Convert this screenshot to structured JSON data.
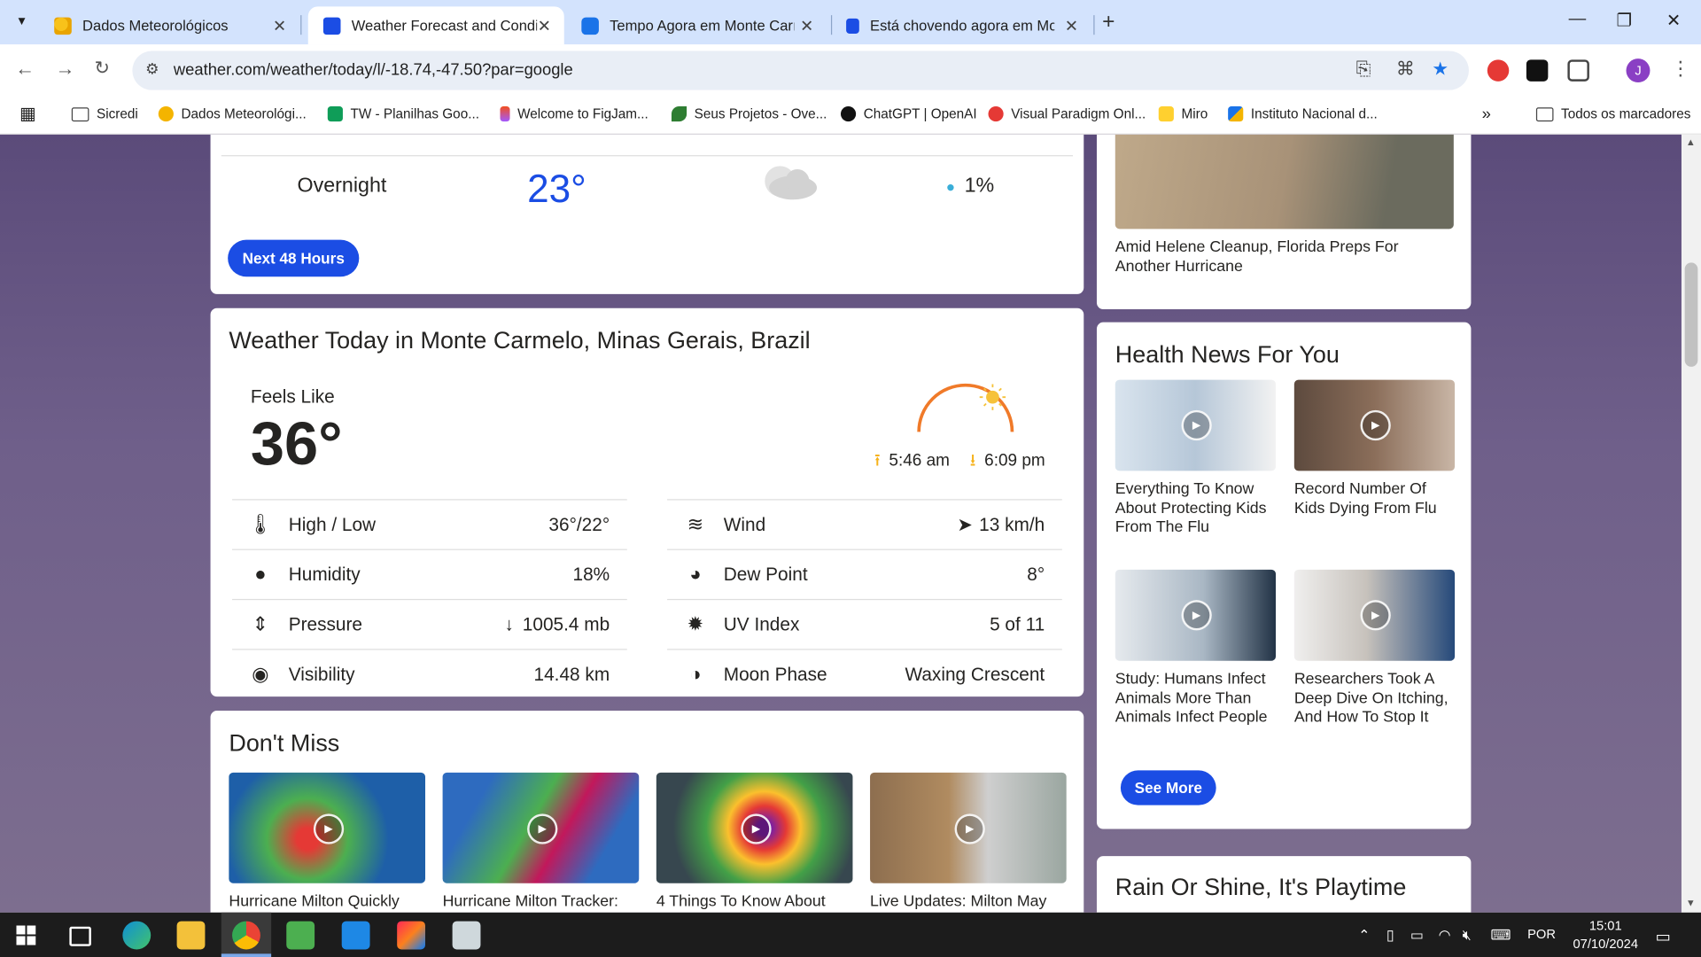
{
  "tabs": [
    {
      "title": "Dados Meteorológicos",
      "favicon_color": "#f4b400"
    },
    {
      "title": "Weather Forecast and Conditions",
      "favicon_color": "#1b4de4"
    },
    {
      "title": "Tempo Agora em Monte Carmelo",
      "favicon_color": "#1a73e8"
    },
    {
      "title": "Está chovendo agora em Monte Carmelo",
      "favicon_color": "#1b4de4"
    }
  ],
  "address": {
    "url": "weather.com/weather/today/l/-18.74,-47.50?par=google"
  },
  "bookmarks": [
    {
      "label": "Sicredi"
    },
    {
      "label": "Dados Meteorológi..."
    },
    {
      "label": "TW - Planilhas Goo..."
    },
    {
      "label": "Welcome to FigJam..."
    },
    {
      "label": "Seus Projetos - Ove..."
    },
    {
      "label": "ChatGPT | OpenAI"
    },
    {
      "label": "Visual Paradigm Onl..."
    },
    {
      "label": "Miro"
    },
    {
      "label": "Instituto Nacional d..."
    },
    {
      "label": "Todos os marcadores"
    }
  ],
  "overnight": {
    "label": "Overnight",
    "temp": "23°",
    "precip": "1%"
  },
  "next48_label": "Next 48 Hours",
  "today": {
    "title": "Weather Today in Monte Carmelo, Minas Gerais, Brazil",
    "feels_like_label": "Feels Like",
    "feels_like_value": "36°",
    "sunrise": "5:46 am",
    "sunset": "6:09 pm",
    "details_left": [
      {
        "label": "High / Low",
        "value": "36°/22°",
        "icon": "thermometer-icon"
      },
      {
        "label": "Humidity",
        "value": "18%",
        "icon": "humidity-icon"
      },
      {
        "label": "Pressure",
        "value": "1005.4 mb",
        "icon": "pressure-icon"
      },
      {
        "label": "Visibility",
        "value": "14.48 km",
        "icon": "visibility-icon"
      }
    ],
    "details_right": [
      {
        "label": "Wind",
        "value": "13 km/h",
        "icon": "wind-icon"
      },
      {
        "label": "Dew Point",
        "value": "8°",
        "icon": "dew-point-icon"
      },
      {
        "label": "UV Index",
        "value": "5 of 11",
        "icon": "uv-index-icon"
      },
      {
        "label": "Moon Phase",
        "value": "Waxing Crescent",
        "icon": "moon-phase-icon"
      }
    ]
  },
  "dont_miss": {
    "title": "Don't Miss",
    "items": [
      {
        "caption": "Hurricane Milton Quickly"
      },
      {
        "caption": "Hurricane Milton Tracker:"
      },
      {
        "caption": "4 Things To Know About"
      },
      {
        "caption": "Live Updates: Milton May"
      }
    ]
  },
  "side_top": {
    "caption": "Amid Helene Cleanup, Florida Preps For Another Hurricane"
  },
  "health": {
    "title": "Health News For You",
    "items": [
      {
        "caption": "Everything To Know About Protecting Kids From The Flu"
      },
      {
        "caption": "Record Number Of Kids Dying From Flu"
      },
      {
        "caption": "Study: Humans Infect Animals More Than Animals Infect People"
      },
      {
        "caption": "Researchers Took A Deep Dive On Itching, And How To Stop It"
      }
    ],
    "see_more": "See More"
  },
  "rain_title": "Rain Or Shine, It's Playtime",
  "taskbar": {
    "lang": "POR",
    "time": "15:01",
    "date": "07/10/2024"
  },
  "colors": {
    "accent": "#1b4de4",
    "tab_strip": "#d3e3fd",
    "page_bg": "#6a5a85"
  }
}
